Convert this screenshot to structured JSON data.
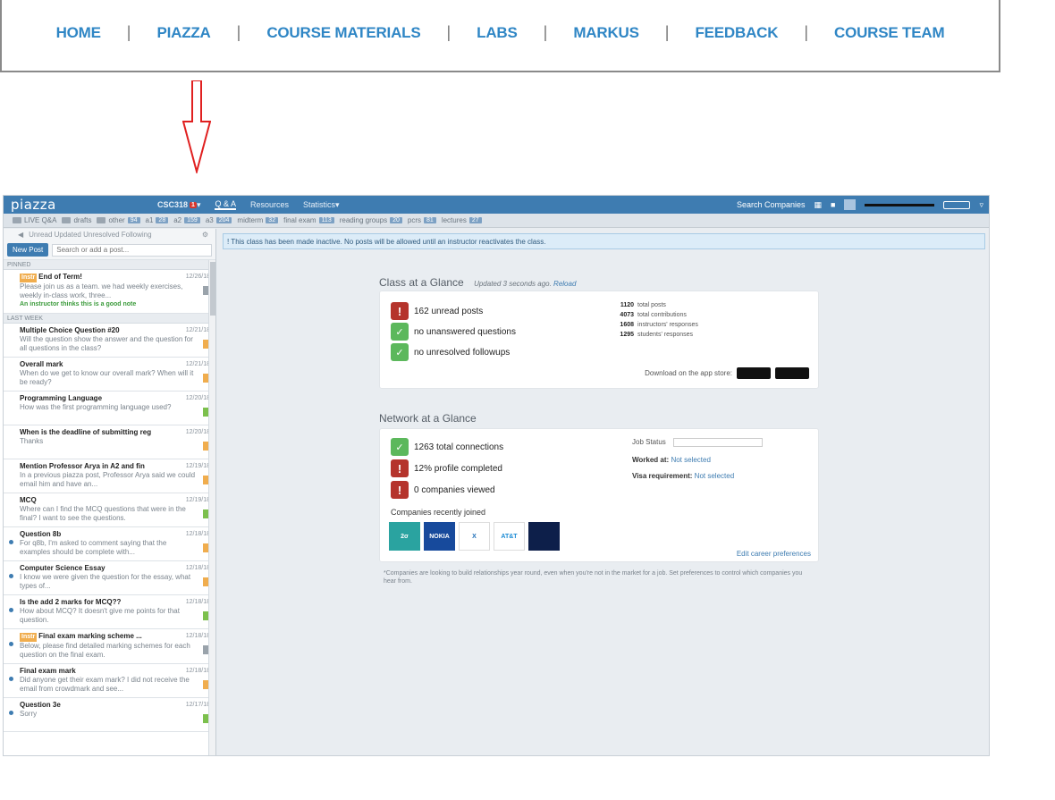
{
  "course_nav": {
    "items": [
      "HOME",
      "PIAZZA",
      "COURSE MATERIALS",
      "LABS",
      "MARKUS",
      "FEEDBACK",
      "COURSE TEAM"
    ]
  },
  "piazza": {
    "logo": "piazza",
    "topbar": {
      "class_name": "CSC318",
      "badge": "1",
      "qa": "Q & A",
      "resources": "Resources",
      "statistics": "Statistics",
      "search_companies": "Search Companies"
    },
    "folders": [
      {
        "label": "LIVE Q&A",
        "count": ""
      },
      {
        "label": "drafts",
        "count": ""
      },
      {
        "label": "other",
        "count": "94"
      },
      {
        "label": "a1",
        "count": "28"
      },
      {
        "label": "a2",
        "count": "159"
      },
      {
        "label": "a3",
        "count": "204"
      },
      {
        "label": "midterm",
        "count": "32"
      },
      {
        "label": "final exam",
        "count": "113"
      },
      {
        "label": "reading groups",
        "count": "20"
      },
      {
        "label": "pcrs",
        "count": "81"
      },
      {
        "label": "lectures",
        "count": "27"
      }
    ],
    "filter_bar": "Unread  Updated  Unresolved  Following",
    "new_post": "New Post",
    "search_placeholder": "Search or add a post...",
    "pinned_label": "PINNED",
    "last_week_label": "LAST WEEK",
    "posts": [
      {
        "tag": "Instr",
        "title": "End of Term!",
        "time": "12/26/18",
        "snippet": "Please join us as a team. we had weekly exercises, weekly in-class work, three...",
        "good": "An instructor thinks this is a good note"
      },
      {
        "tag": "",
        "title": "Multiple Choice Question #20",
        "time": "12/21/18",
        "snippet": "Will the question show the answer and the question for all questions in the class?"
      },
      {
        "tag": "",
        "title": "Overall mark",
        "time": "12/21/18",
        "snippet": "When do we get to know our overall mark? When will it be ready?"
      },
      {
        "tag": "",
        "title": "Programming Language",
        "time": "12/20/18",
        "snippet": "How was the first programming language used?"
      },
      {
        "tag": "",
        "title": "When is the deadline of submitting reg",
        "time": "12/20/18",
        "snippet": "Thanks"
      },
      {
        "tag": "",
        "title": "Mention Professor Arya in A2 and fin",
        "time": "12/19/18",
        "snippet": "In a previous piazza post, Professor Arya said we could email him and have an..."
      },
      {
        "tag": "",
        "title": "MCQ",
        "time": "12/19/18",
        "snippet": "Where can I find the MCQ questions that were in the final? I want to see the questions."
      },
      {
        "tag": "",
        "title": "Question 8b",
        "time": "12/18/18",
        "snippet": "For q8b, I'm asked to comment saying that the examples should be complete with..."
      },
      {
        "tag": "",
        "title": "Computer Science Essay",
        "time": "12/18/18",
        "snippet": "I know we were given the question for the essay, what types of..."
      },
      {
        "tag": "",
        "title": "Is the add 2 marks for MCQ??",
        "time": "12/18/18",
        "snippet": "How about MCQ? It doesn't give me points for that question."
      },
      {
        "tag": "Instr",
        "title": "Final exam marking scheme ...",
        "time": "12/18/18",
        "snippet": "Below, please find detailed marking schemes for each question on the final exam."
      },
      {
        "tag": "",
        "title": "Final exam mark",
        "time": "12/18/18",
        "snippet": "Did anyone get their exam mark? I did not receive the email from crowdmark and see..."
      },
      {
        "tag": "",
        "title": "Question 3e",
        "time": "12/17/18",
        "snippet": "Sorry"
      }
    ],
    "notice": "! This class has been made inactive. No posts will be allowed until an instructor reactivates the class.",
    "class_glance": {
      "title": "Class at a Glance",
      "updated": "Updated",
      "updated_time": "3 seconds ago.",
      "reload": "Reload",
      "stats": [
        "162 unread posts",
        "no unanswered questions",
        "no unresolved followups"
      ],
      "mini": [
        {
          "num": "1120",
          "label": "total posts"
        },
        {
          "num": "4073",
          "label": "total contributions"
        },
        {
          "num": "1608",
          "label": "instructors' responses"
        },
        {
          "num": "1295",
          "label": "students' responses"
        }
      ],
      "download": "Download on the app store:"
    },
    "network_glance": {
      "title": "Network at a Glance",
      "stats": [
        "1263 total connections",
        "12% profile completed",
        "0 companies viewed"
      ],
      "job_status_label": "Job Status",
      "worked_at_label": "Worked at:",
      "worked_at_value": "Not selected",
      "visa_label": "Visa requirement:",
      "visa_value": "Not selected",
      "companies_label": "Companies recently joined",
      "companies": [
        "2σ",
        "NOKIA",
        "X",
        "AT&T",
        ""
      ],
      "edit_prefs": "Edit career preferences",
      "footnote": "*Companies are looking to build relationships year round, even when you're not in the market for a job. Set preferences to control which companies you hear from."
    }
  }
}
